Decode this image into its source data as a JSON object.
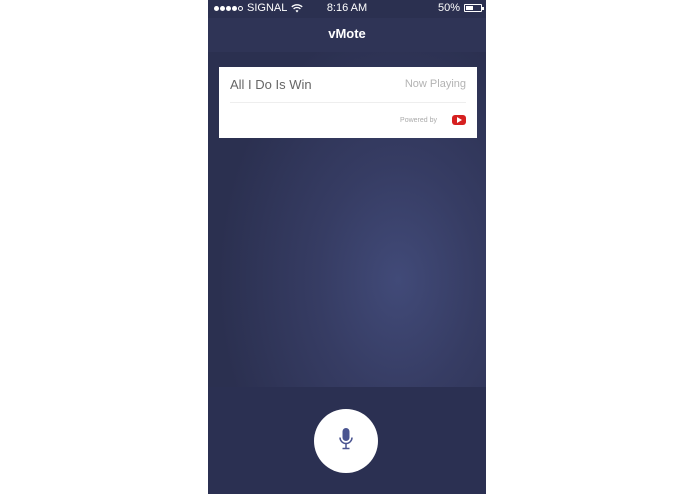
{
  "status_bar": {
    "signal_strength_dots": 4,
    "signal_total_dots": 5,
    "carrier": "SIGNAL",
    "time": "8:16 AM",
    "battery_percent": "50%",
    "battery_level": 0.5,
    "wifi_icon": "wifi-icon",
    "battery_icon": "battery-icon"
  },
  "nav": {
    "title": "vMote"
  },
  "now_playing_card": {
    "track_title": "All I Do Is Win",
    "status": "Now Playing",
    "powered_by": "Powered by",
    "provider_icon": "youtube-icon"
  },
  "controls": {
    "mic_icon": "microphone-icon"
  },
  "colors": {
    "background": "#363c63",
    "nav_bar": "#2f3456",
    "bottom_bar": "#2b3052",
    "mic_icon": "#4a5490",
    "provider_red": "#d62020"
  }
}
